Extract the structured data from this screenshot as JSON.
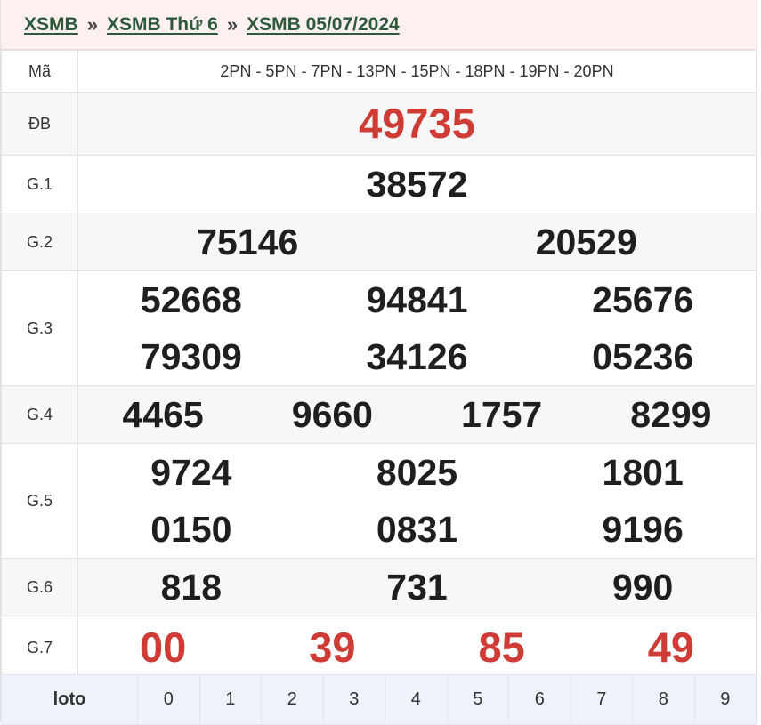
{
  "breadcrumb": {
    "items": [
      "XSMB",
      "XSMB Thứ 6",
      "XSMB 05/07/2024"
    ],
    "separator": "»"
  },
  "table": {
    "ma": {
      "label": "Mã",
      "codes": "2PN - 5PN - 7PN - 13PN - 15PN - 18PN - 19PN - 20PN"
    },
    "db": {
      "label": "ĐB",
      "numbers": [
        "49735"
      ]
    },
    "g1": {
      "label": "G.1",
      "numbers": [
        "38572"
      ]
    },
    "g2": {
      "label": "G.2",
      "numbers": [
        "75146",
        "20529"
      ]
    },
    "g3": {
      "label": "G.3",
      "numbers": [
        "52668",
        "94841",
        "25676",
        "79309",
        "34126",
        "05236"
      ]
    },
    "g4": {
      "label": "G.4",
      "numbers": [
        "4465",
        "9660",
        "1757",
        "8299"
      ]
    },
    "g5": {
      "label": "G.5",
      "numbers": [
        "9724",
        "8025",
        "1801",
        "0150",
        "0831",
        "9196"
      ]
    },
    "g6": {
      "label": "G.6",
      "numbers": [
        "818",
        "731",
        "990"
      ]
    },
    "g7": {
      "label": "G.7",
      "numbers": [
        "00",
        "39",
        "85",
        "49"
      ]
    }
  },
  "loto": {
    "head": "loto",
    "digits": [
      "0",
      "1",
      "2",
      "3",
      "4",
      "5",
      "6",
      "7",
      "8",
      "9"
    ]
  },
  "colors": {
    "highlight": "#cf3b35",
    "link": "#2c5a3a",
    "crumb_bg": "#fdf0f0",
    "loto_bg": "#eef2fb"
  }
}
